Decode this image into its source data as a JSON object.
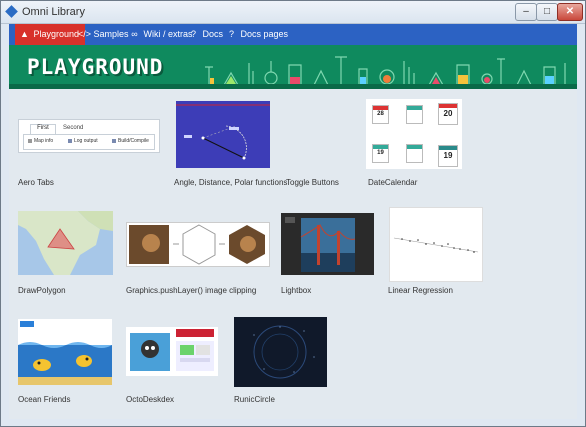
{
  "window": {
    "title": "Omni Library",
    "controls": {
      "minimize": "–",
      "maximize": "□",
      "close": "✕"
    }
  },
  "nav": {
    "items": [
      {
        "label": "Playground",
        "icon": "flask-icon",
        "glyph": "▲",
        "active": true
      },
      {
        "label": "Samples",
        "icon": "code-icon",
        "glyph": "</>"
      },
      {
        "label": "Wiki / extras",
        "icon": "link-icon",
        "glyph": "∞"
      },
      {
        "label": "Docs",
        "icon": "help-icon",
        "glyph": "?"
      },
      {
        "label": "Docs pages",
        "icon": "help-icon",
        "glyph": "?"
      }
    ]
  },
  "banner": {
    "title": "PLAYGROUND"
  },
  "tiles": [
    {
      "label": "Aero Tabs",
      "preview": {
        "tabs": [
          "First",
          "Second"
        ],
        "items": [
          "Map info",
          "Log output",
          "Build/Compile"
        ]
      }
    },
    {
      "label": "Angle, Distance, Polar functions"
    },
    {
      "label": "Toggle Buttons"
    },
    {
      "label": "DateCalendar",
      "preview": {
        "days": [
          "28",
          "20",
          "19",
          "19"
        ]
      }
    },
    {
      "label": "DrawPolygon"
    },
    {
      "label": "Graphics.pushLayer() image clipping"
    },
    {
      "label": "Lightbox"
    },
    {
      "label": "Linear Regression"
    },
    {
      "label": "Ocean Friends"
    },
    {
      "label": "OctoDeskdex"
    },
    {
      "label": "RunicCircle"
    }
  ],
  "colors": {
    "nav": "#2c62c3",
    "nav_active": "#d8312b",
    "banner": "#0f8a5e",
    "content": "#e2e9ef"
  }
}
